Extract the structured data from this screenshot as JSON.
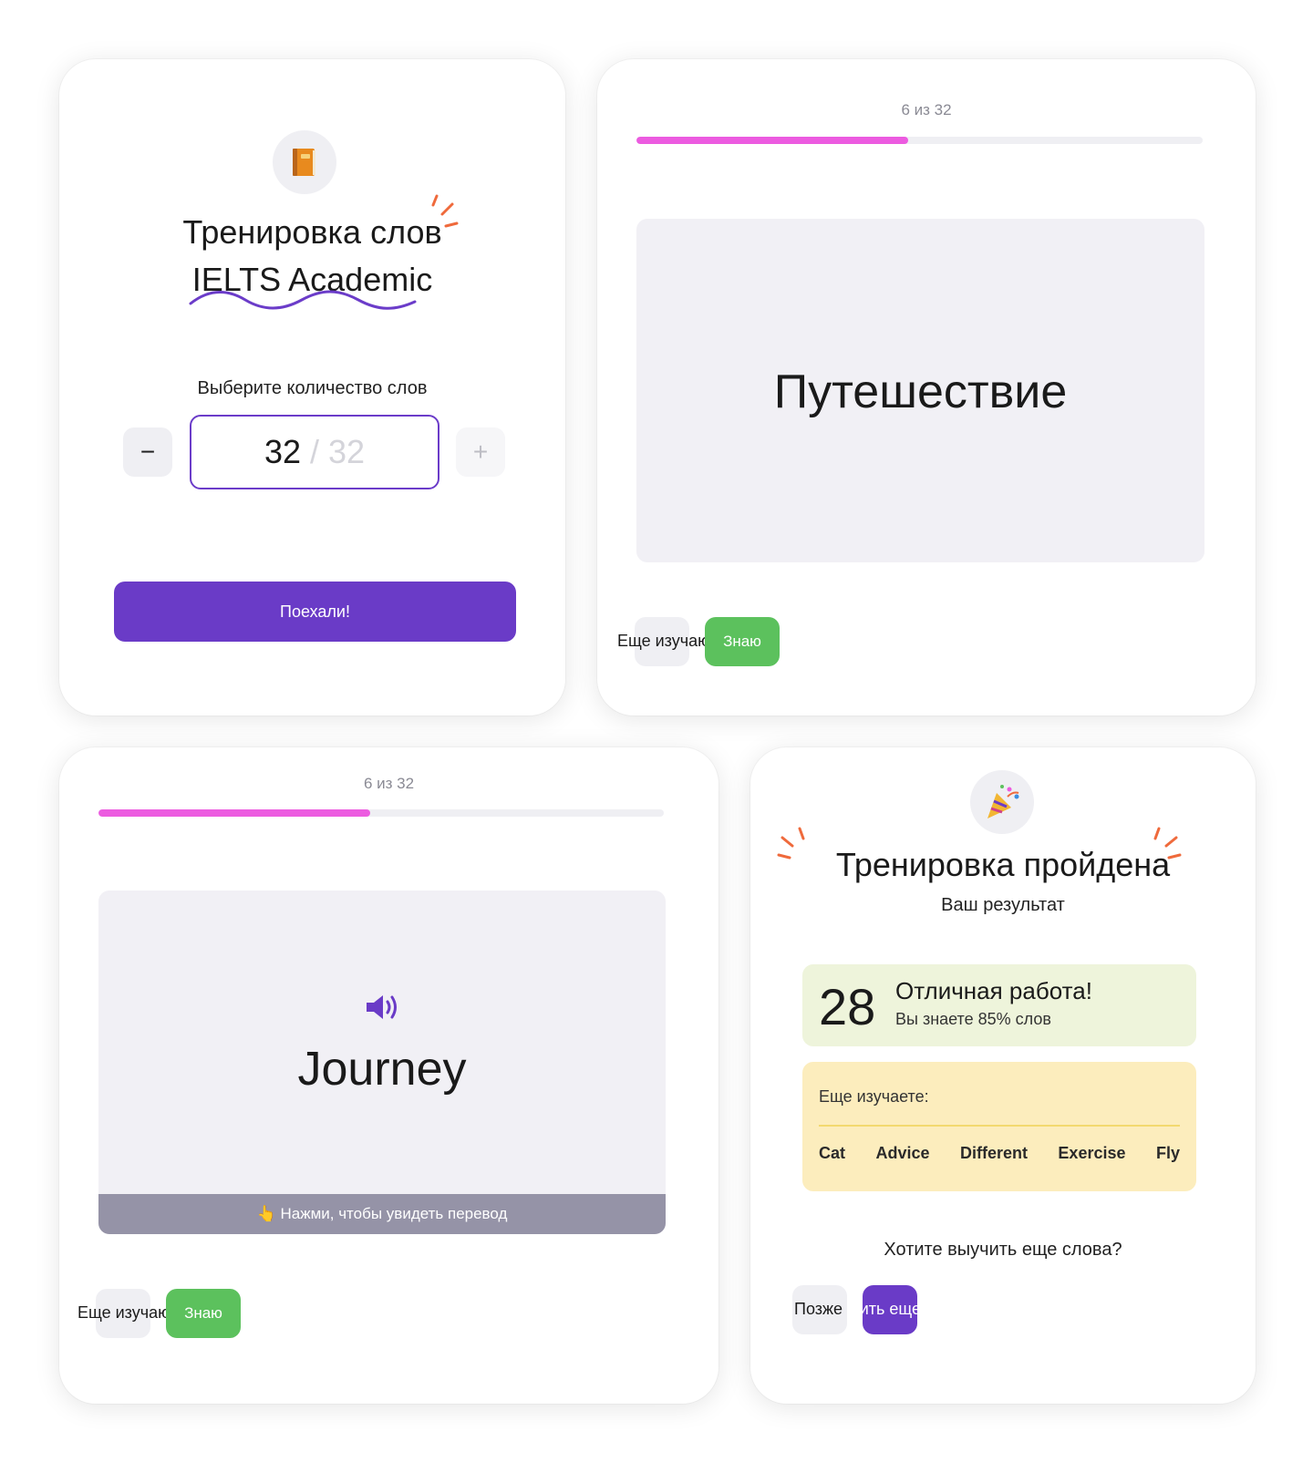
{
  "setup": {
    "icon": "book-emoji",
    "title_line1": "Тренировка слов",
    "title_line2": "IELTS Academic",
    "count_label": "Выберите количество слов",
    "minus_label": "−",
    "plus_label": "+",
    "count_value": "32",
    "count_max": "/ 32",
    "start_label": "Поехали!"
  },
  "card_word": {
    "progress_text": "6 из 32",
    "progress_fraction": 0.48,
    "word": "Путешествие",
    "still_learning_label": "Еще изучаю",
    "know_label": "Знаю"
  },
  "card_translation": {
    "progress_text": "6 из 32",
    "progress_fraction": 0.48,
    "icon": "speaker-icon",
    "word": "Journey",
    "hint": "👆 Нажми, чтобы увидеть перевод",
    "still_learning_label": "Еще изучаю",
    "know_label": "Знаю"
  },
  "result": {
    "icon": "party-popper-emoji",
    "title": "Тренировка пройдена",
    "subtitle": "Ваш результат",
    "score": "28",
    "score_headline": "Отличная работа!",
    "score_detail": "Вы знаете 85% слов",
    "learning_label": "Еще изучаете:",
    "learning_words": [
      "Cat",
      "Advice",
      "Different",
      "Exercise",
      "Fly"
    ],
    "question": "Хотите выучить еще слова?",
    "later_label": "Позже",
    "more_label": "Учить еще"
  },
  "colors": {
    "accent": "#6a3bc7",
    "progress": "#ec5be0",
    "know": "#5cc15d",
    "card_bg": "#f1f0f5",
    "score_bg": "#eef4db",
    "learning_bg": "#fcedbd",
    "spark": "#ef6a3c"
  }
}
